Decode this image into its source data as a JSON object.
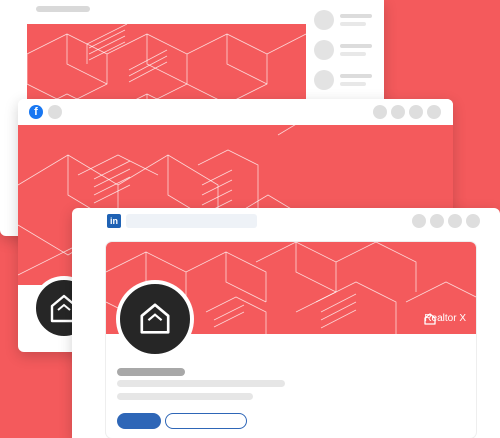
{
  "brand": {
    "name": "Realtor X",
    "accent": "#f45a5c"
  },
  "windows": {
    "back": {
      "platform": "generic",
      "sidebar_rows": 3
    },
    "middle": {
      "platform": "facebook",
      "icon": "facebook-icon",
      "brand_color": "#1877f2",
      "title_dots": 4
    },
    "front": {
      "platform": "linkedin",
      "icon": "linkedin-icon",
      "brand_color": "#1f62b4",
      "title_dots": 4
    }
  },
  "icons": {
    "house": "house-outline-icon",
    "tag": "tag-icon"
  }
}
